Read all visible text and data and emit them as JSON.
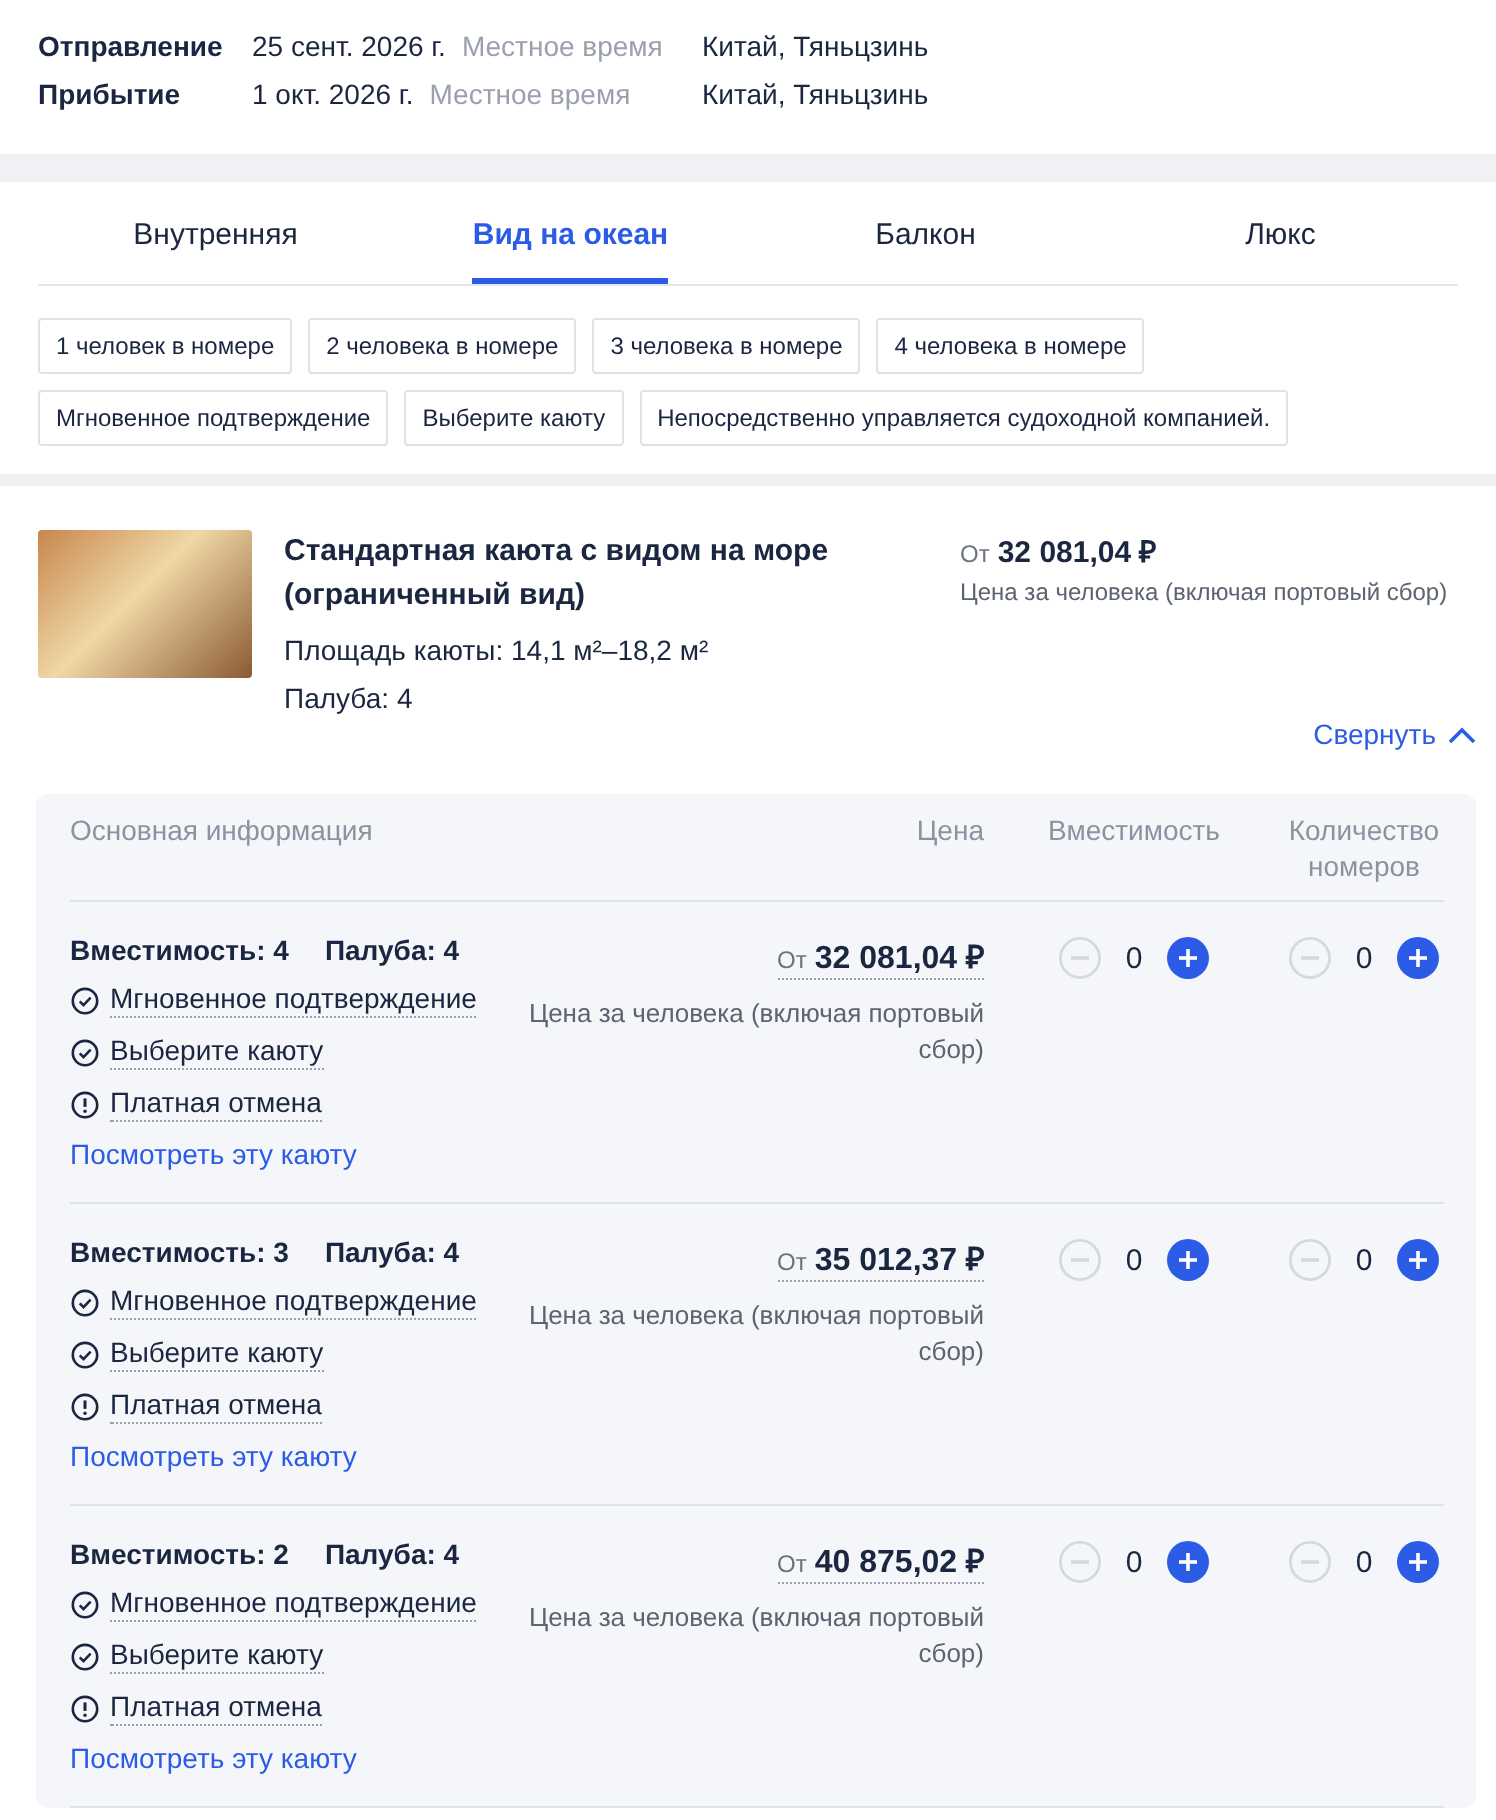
{
  "schedule": [
    {
      "label": "Отправление",
      "date": "25 сент. 2026 г.",
      "note": "Местное время",
      "place": "Китай, Тяньцзинь"
    },
    {
      "label": "Прибытие",
      "date": "1 окт. 2026 г.",
      "note": "Местное время",
      "place": "Китай, Тяньцзинь"
    }
  ],
  "tabs": [
    {
      "label": "Внутренняя",
      "selected": false
    },
    {
      "label": "Вид на океан",
      "selected": true
    },
    {
      "label": "Балкон",
      "selected": false
    },
    {
      "label": "Люкс",
      "selected": false
    }
  ],
  "filters": [
    [
      "1 человек в номере",
      "2 человека в номере",
      "3 человека в номере",
      "4 человека в номере"
    ],
    [
      "Мгновенное подтверждение",
      "Выберите каюту",
      "Непосредственно управляется судоходной компанией."
    ]
  ],
  "cabin": {
    "title": "Стандартная каюта с видом на море (ограниченный вид)",
    "area": "Площадь каюты: 14,1 м²–18,2 м²",
    "deck": "Палуба: 4",
    "price_prefix": "От",
    "price": "32 081,04 ₽",
    "price_note": "Цена за человека (включая портовый сбор)",
    "collapse": "Свернуть"
  },
  "table": {
    "columns": [
      "Основная информация",
      "Цена",
      "Вместимость",
      "Количество номеров"
    ],
    "rows": [
      {
        "capacity": "Вместимость: 4",
        "deck": "Палуба: 4",
        "features": [
          {
            "kind": "check",
            "label": "Мгновенное подтверждение"
          },
          {
            "kind": "check",
            "label": "Выберите каюту"
          },
          {
            "kind": "alert",
            "label": "Платная отмена"
          }
        ],
        "link": "Посмотреть эту каюту",
        "price_prefix": "От",
        "price": "32 081,04 ₽",
        "price_note": "Цена за человека (включая портовый сбор)",
        "counters": [
          {
            "value": "0",
            "can_decrease": false,
            "can_increase": true
          },
          {
            "value": "0",
            "can_decrease": false,
            "can_increase": true
          }
        ]
      },
      {
        "capacity": "Вместимость: 3",
        "deck": "Палуба: 4",
        "features": [
          {
            "kind": "check",
            "label": "Мгновенное подтверждение"
          },
          {
            "kind": "check",
            "label": "Выберите каюту"
          },
          {
            "kind": "alert",
            "label": "Платная отмена"
          }
        ],
        "link": "Посмотреть эту каюту",
        "price_prefix": "От",
        "price": "35 012,37 ₽",
        "price_note": "Цена за человека (включая портовый сбор)",
        "counters": [
          {
            "value": "0",
            "can_decrease": false,
            "can_increase": true
          },
          {
            "value": "0",
            "can_decrease": false,
            "can_increase": true
          }
        ]
      },
      {
        "capacity": "Вместимость: 2",
        "deck": "Палуба: 4",
        "features": [
          {
            "kind": "check",
            "label": "Мгновенное подтверждение"
          },
          {
            "kind": "check",
            "label": "Выберите каюту"
          },
          {
            "kind": "alert",
            "label": "Платная отмена"
          }
        ],
        "link": "Посмотреть эту каюту",
        "price_prefix": "От",
        "price": "40 875,02 ₽",
        "price_note": "Цена за человека (включая портовый сбор)",
        "counters": [
          {
            "value": "0",
            "can_decrease": false,
            "can_increase": true
          },
          {
            "value": "0",
            "can_decrease": false,
            "can_increase": true
          }
        ]
      }
    ]
  }
}
